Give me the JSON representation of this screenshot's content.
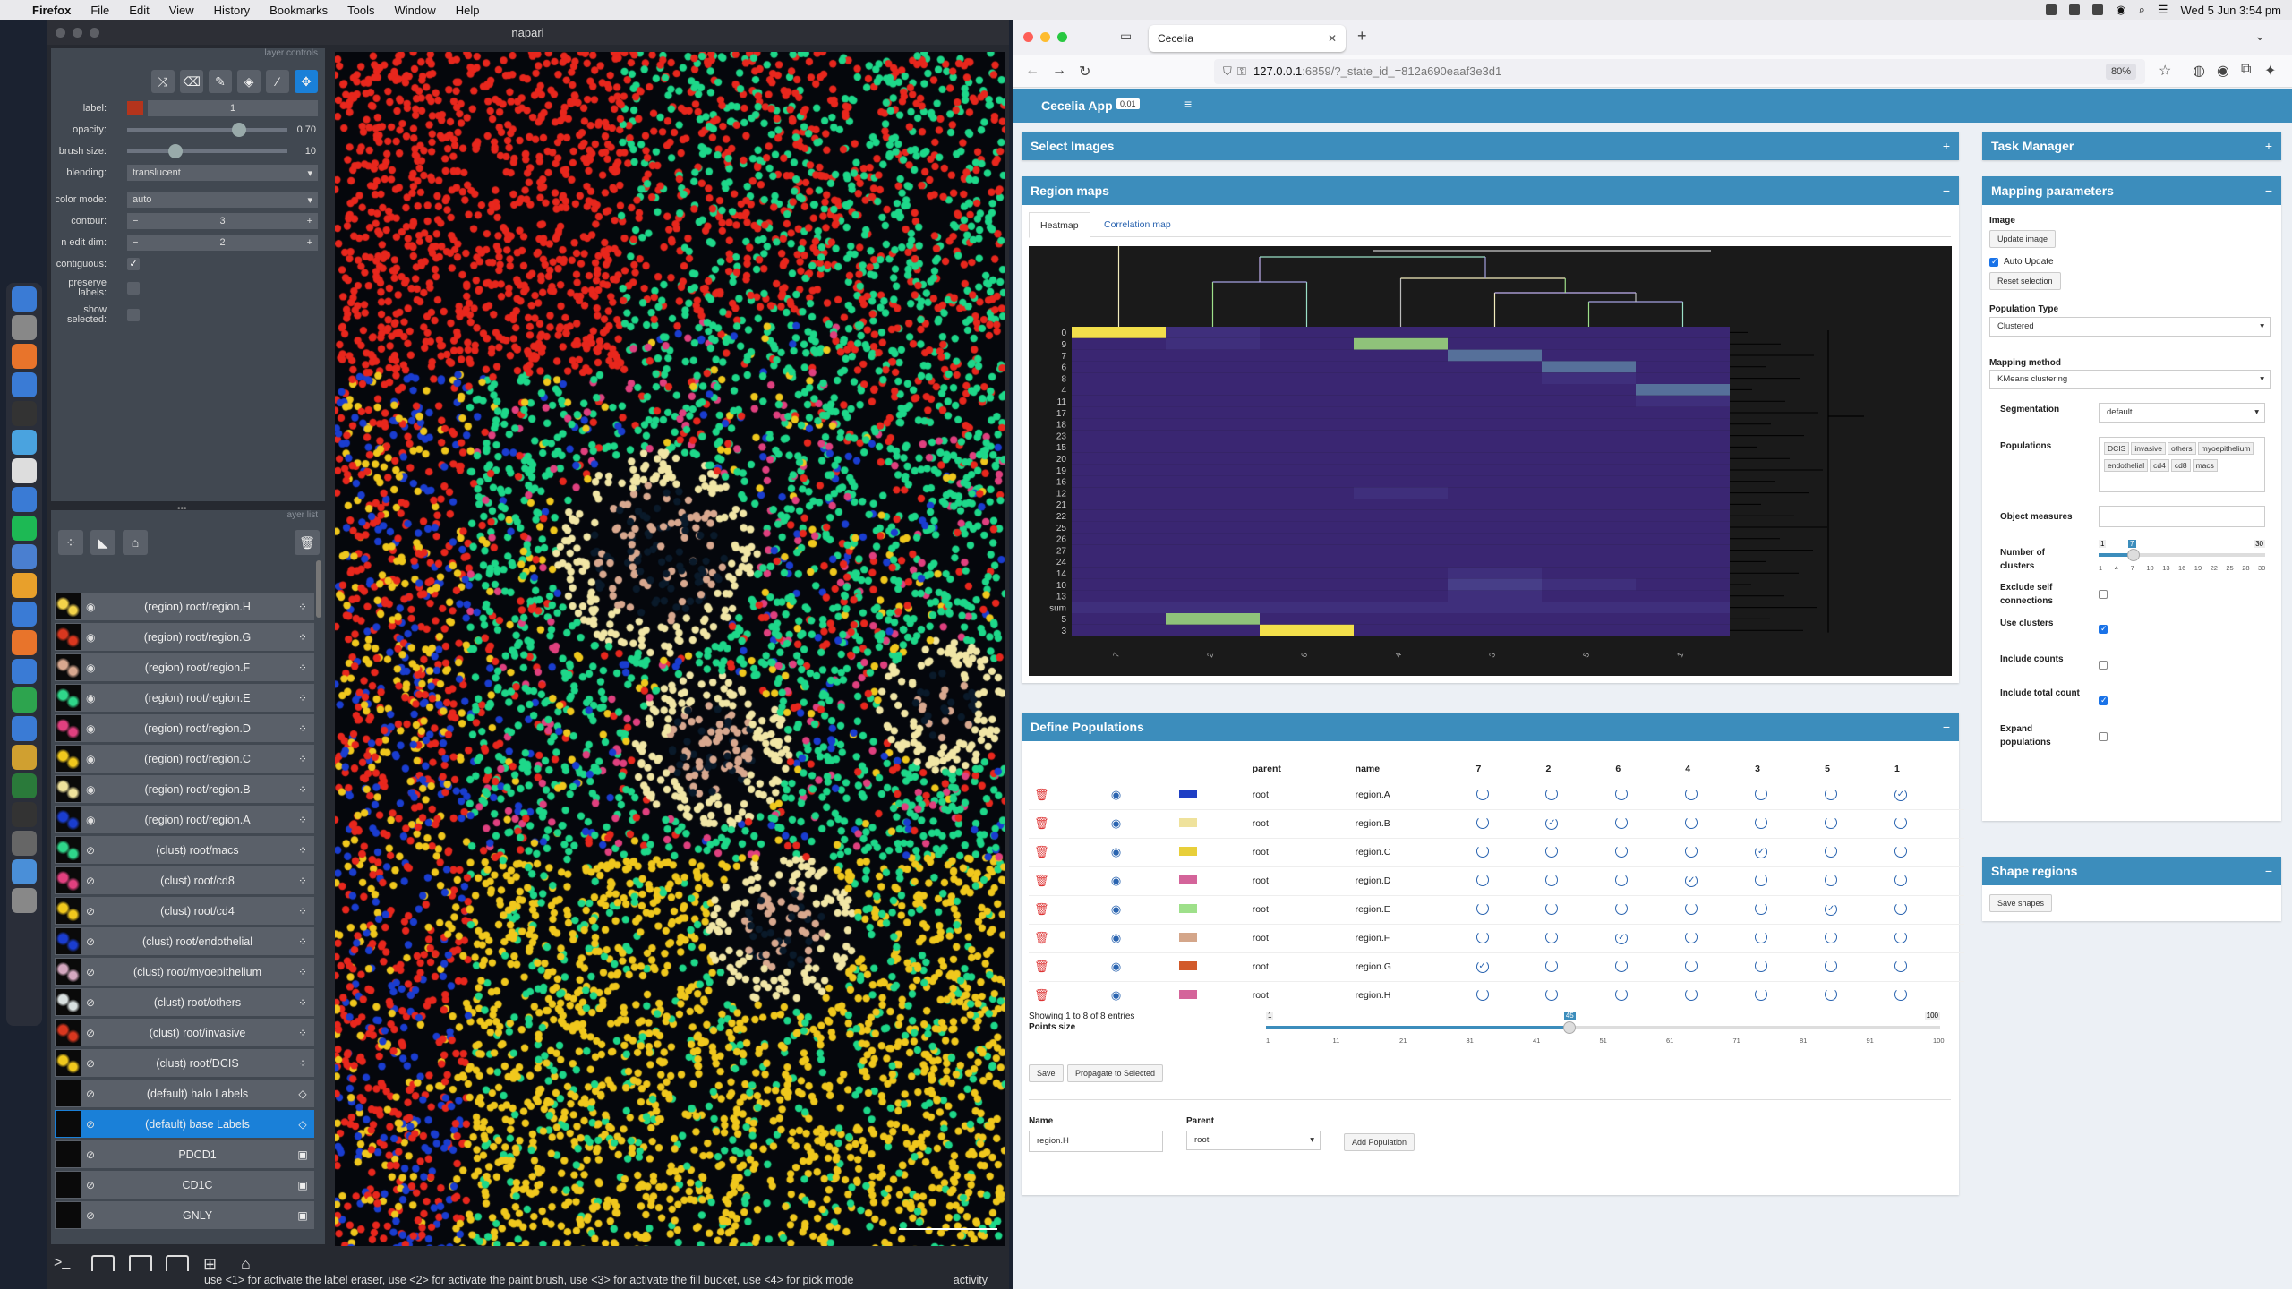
{
  "menubar": {
    "app": "Firefox",
    "items": [
      "File",
      "Edit",
      "View",
      "History",
      "Bookmarks",
      "Tools",
      "Window",
      "Help"
    ],
    "clock": "Wed 5 Jun  3:54 pm"
  },
  "napari": {
    "title": "napari",
    "layer_controls_header": "layer controls",
    "layer_list_header": "layer list",
    "controls": {
      "label_lbl": "label:",
      "label_val": "1",
      "opacity_lbl": "opacity:",
      "opacity_val": "0.70",
      "opacity_frac": 0.7,
      "brush_lbl": "brush size:",
      "brush_val": "10",
      "brush_frac": 0.3,
      "blending_lbl": "blending:",
      "blending_val": "translucent",
      "color_mode_lbl": "color mode:",
      "color_mode_val": "auto",
      "contour_lbl": "contour:",
      "contour_val": "3",
      "n_edit_lbl": "n edit dim:",
      "n_edit_val": "2",
      "contiguous_lbl": "contiguous:",
      "preserve_lbl": "preserve labels:",
      "show_sel_lbl": "show selected:"
    },
    "layers": [
      {
        "name": "(region) root/region.H",
        "visible": true,
        "sel": false
      },
      {
        "name": "(region) root/region.G",
        "visible": true,
        "sel": false
      },
      {
        "name": "(region) root/region.F",
        "visible": true,
        "sel": false
      },
      {
        "name": "(region) root/region.E",
        "visible": true,
        "sel": false
      },
      {
        "name": "(region) root/region.D",
        "visible": true,
        "sel": false
      },
      {
        "name": "(region) root/region.C",
        "visible": true,
        "sel": false
      },
      {
        "name": "(region) root/region.B",
        "visible": true,
        "sel": false
      },
      {
        "name": "(region) root/region.A",
        "visible": true,
        "sel": false
      },
      {
        "name": "(clust) root/macs",
        "visible": false,
        "sel": false
      },
      {
        "name": "(clust) root/cd8",
        "visible": false,
        "sel": false
      },
      {
        "name": "(clust) root/cd4",
        "visible": false,
        "sel": false
      },
      {
        "name": "(clust) root/endothelial",
        "visible": false,
        "sel": false
      },
      {
        "name": "(clust) root/myoepithelium",
        "visible": false,
        "sel": false
      },
      {
        "name": "(clust) root/others",
        "visible": false,
        "sel": false
      },
      {
        "name": "(clust) root/invasive",
        "visible": false,
        "sel": false
      },
      {
        "name": "(clust) root/DCIS",
        "visible": false,
        "sel": false
      },
      {
        "name": "(default) halo Labels",
        "visible": false,
        "sel": false
      },
      {
        "name": "(default) base Labels",
        "visible": false,
        "sel": true
      },
      {
        "name": "PDCD1",
        "visible": false,
        "sel": false
      },
      {
        "name": "CD1C",
        "visible": false,
        "sel": false
      },
      {
        "name": "GNLY",
        "visible": false,
        "sel": false
      }
    ],
    "status": "use <1> for activate the label eraser, use <2> for activate the paint brush, use <3> for activate the fill bucket, use <4> for pick mode",
    "activity": "activity"
  },
  "firefox": {
    "tab_title": "Cecelia",
    "url_host": "127.0.0.1",
    "url_rest": ":6859/?_state_id_=812a690eaaf3e3d1",
    "zoom": "80%"
  },
  "app": {
    "name": "Cecelia App",
    "version": "0.01",
    "select_images": "Select Images",
    "region_maps": "Region maps",
    "tab_heatmap": "Heatmap",
    "tab_corr": "Correlation map",
    "define_pops": "Define Populations",
    "task_manager": "Task Manager",
    "mapping_params": "Mapping parameters",
    "shape_regions": "Shape regions",
    "save_shapes": "Save shapes"
  },
  "chart_data": {
    "type": "heatmap",
    "row_labels": [
      "0",
      "9",
      "7",
      "6",
      "8",
      "4",
      "11",
      "17",
      "18",
      "23",
      "15",
      "20",
      "19",
      "16",
      "12",
      "21",
      "22",
      "25",
      "26",
      "27",
      "24",
      "14",
      "10",
      "13",
      "sum",
      "5",
      "3"
    ],
    "col_labels": [
      "7",
      "2",
      "6",
      "4",
      "3",
      "5",
      "1"
    ],
    "values": [
      [
        0.95,
        0.15,
        0.1,
        0.1,
        0.1,
        0.1,
        0.1
      ],
      [
        0.1,
        0.15,
        0.12,
        0.6,
        0.1,
        0.1,
        0.1
      ],
      [
        0.1,
        0.12,
        0.1,
        0.1,
        0.5,
        0.12,
        0.1
      ],
      [
        0.1,
        0.1,
        0.1,
        0.1,
        0.12,
        0.35,
        0.1
      ],
      [
        0.12,
        0.1,
        0.1,
        0.1,
        0.1,
        0.18,
        0.12
      ],
      [
        0.1,
        0.1,
        0.1,
        0.1,
        0.1,
        0.1,
        0.35
      ],
      [
        0.1,
        0.1,
        0.1,
        0.1,
        0.1,
        0.1,
        0.15
      ],
      [
        0.1,
        0.1,
        0.1,
        0.1,
        0.1,
        0.1,
        0.1
      ],
      [
        0.1,
        0.1,
        0.1,
        0.1,
        0.1,
        0.1,
        0.1
      ],
      [
        0.1,
        0.1,
        0.1,
        0.1,
        0.1,
        0.1,
        0.1
      ],
      [
        0.1,
        0.1,
        0.1,
        0.1,
        0.1,
        0.1,
        0.1
      ],
      [
        0.1,
        0.1,
        0.1,
        0.1,
        0.1,
        0.1,
        0.1
      ],
      [
        0.1,
        0.1,
        0.1,
        0.1,
        0.1,
        0.1,
        0.1
      ],
      [
        0.1,
        0.1,
        0.1,
        0.1,
        0.1,
        0.1,
        0.1
      ],
      [
        0.1,
        0.1,
        0.1,
        0.15,
        0.1,
        0.1,
        0.1
      ],
      [
        0.1,
        0.12,
        0.1,
        0.1,
        0.1,
        0.1,
        0.1
      ],
      [
        0.1,
        0.1,
        0.1,
        0.1,
        0.1,
        0.1,
        0.1
      ],
      [
        0.1,
        0.1,
        0.1,
        0.1,
        0.1,
        0.1,
        0.1
      ],
      [
        0.1,
        0.1,
        0.1,
        0.1,
        0.1,
        0.1,
        0.1
      ],
      [
        0.1,
        0.1,
        0.1,
        0.1,
        0.1,
        0.1,
        0.1
      ],
      [
        0.1,
        0.1,
        0.1,
        0.1,
        0.1,
        0.1,
        0.1
      ],
      [
        0.1,
        0.1,
        0.1,
        0.1,
        0.15,
        0.1,
        0.1
      ],
      [
        0.1,
        0.1,
        0.1,
        0.1,
        0.2,
        0.15,
        0.1
      ],
      [
        0.1,
        0.1,
        0.1,
        0.1,
        0.15,
        0.1,
        0.1
      ],
      [
        0.15,
        0.15,
        0.15,
        0.15,
        0.15,
        0.15,
        0.15
      ],
      [
        0.1,
        0.55,
        0.1,
        0.1,
        0.1,
        0.1,
        0.1
      ],
      [
        0.1,
        0.1,
        0.95,
        0.1,
        0.1,
        0.1,
        0.1
      ]
    ]
  },
  "populations": {
    "headers": [
      "parent",
      "name",
      "7",
      "2",
      "6",
      "4",
      "3",
      "5",
      "1"
    ],
    "rows": [
      {
        "parent": "root",
        "name": "region.A",
        "color": "#1f3fc4",
        "checked": 6
      },
      {
        "parent": "root",
        "name": "region.B",
        "color": "#efe29c",
        "checked": 1
      },
      {
        "parent": "root",
        "name": "region.C",
        "color": "#e8cf3a",
        "checked": 4
      },
      {
        "parent": "root",
        "name": "region.D",
        "color": "#d4649a",
        "checked": 3
      },
      {
        "parent": "root",
        "name": "region.E",
        "color": "#9ee08a",
        "checked": 5
      },
      {
        "parent": "root",
        "name": "region.F",
        "color": "#d4a68a",
        "checked": 2
      },
      {
        "parent": "root",
        "name": "region.G",
        "color": "#d25a2a",
        "checked": 0
      },
      {
        "parent": "root",
        "name": "region.H",
        "color": "#d4649a",
        "checked": -1
      }
    ],
    "showing": "Showing 1 to 8 of 8 entries",
    "points_size": "Points size",
    "pts_min": "1",
    "pts_max": "100",
    "pts_val": "45",
    "pts_frac": 0.45,
    "pts_ticks": [
      "1",
      "11",
      "21",
      "31",
      "41",
      "51",
      "61",
      "71",
      "81",
      "91",
      "100"
    ],
    "save": "Save",
    "propagate": "Propagate to Selected",
    "name_lbl": "Name",
    "name_val": "region.H",
    "parent_lbl": "Parent",
    "parent_val": "root",
    "add_pop": "Add Population"
  },
  "mapping": {
    "image_lbl": "Image",
    "update_image": "Update image",
    "auto_update": "Auto Update",
    "reset_sel": "Reset selection",
    "pop_type_lbl": "Population Type",
    "pop_type_val": "Clustered",
    "method_lbl": "Mapping method",
    "method_val": "KMeans clustering",
    "seg_lbl": "Segmentation",
    "seg_val": "default",
    "pops_lbl": "Populations",
    "pops_tags": [
      "DCIS",
      "invasive",
      "others",
      "myoepithelium",
      "endothelial",
      "cd4",
      "cd8",
      "macs"
    ],
    "obj_lbl": "Object measures",
    "ncl_lbl": "Number of clusters",
    "ncl_min": "1",
    "ncl_max": "30",
    "ncl_val": "7",
    "ncl_frac": 0.21,
    "ncl_ticks": [
      "1",
      "4",
      "7",
      "10",
      "13",
      "16",
      "19",
      "22",
      "25",
      "28",
      "30"
    ],
    "excl_lbl": "Exclude self connections",
    "use_cl_lbl": "Use clusters",
    "inc_counts_lbl": "Include counts",
    "inc_total_lbl": "Include total count",
    "expand_lbl": "Expand populations"
  }
}
